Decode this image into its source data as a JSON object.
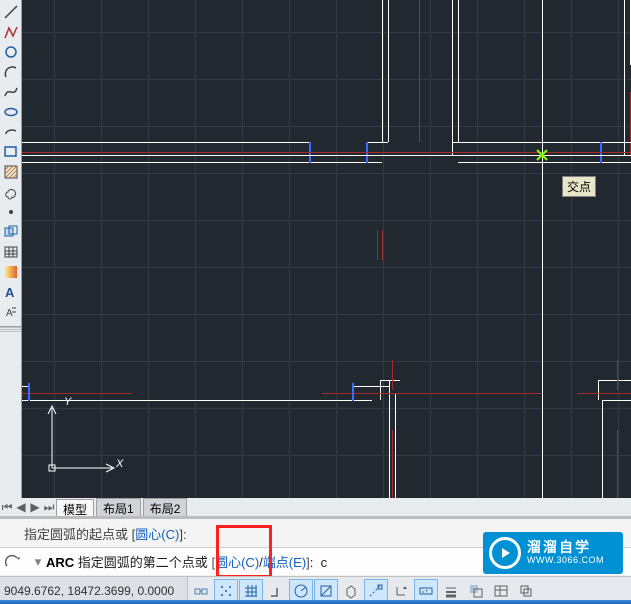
{
  "toolbar": {
    "icons": [
      "line-icon",
      "polyline-icon",
      "arc-icon",
      "spline-icon",
      "rectangle-icon",
      "revcloud-icon",
      "ellipse-icon",
      "hatch-icon",
      "point-icon",
      "region-icon",
      "table-icon",
      "text-icon",
      "mtext-icon",
      "gradient-icon"
    ]
  },
  "canvas": {
    "snap_label": "交点",
    "ucs_x": "X",
    "ucs_y": "Y"
  },
  "tabs": {
    "items": [
      "模型",
      "布局1",
      "布局2"
    ],
    "active_index": 0
  },
  "command": {
    "history_prefix": "指定圆弧的起点或",
    "history_opt_label": "圆心",
    "history_opt_key": "C",
    "prompt_cmd": "ARC",
    "prompt_text": "指定圆弧的第二个点或",
    "prompt_opts": [
      {
        "label": "圆心",
        "key": "C"
      },
      {
        "label": "端点",
        "key": "E"
      }
    ],
    "input_value": "c"
  },
  "status": {
    "coords": "9049.6762, 18472.3699, 0.0000",
    "buttons": [
      {
        "name": "infer-constraints",
        "active": false
      },
      {
        "name": "snap-mode",
        "active": true
      },
      {
        "name": "grid-display",
        "active": true
      },
      {
        "name": "ortho-mode",
        "active": false
      },
      {
        "name": "polar-tracking",
        "active": true
      },
      {
        "name": "object-snap",
        "active": true
      },
      {
        "name": "3d-osnap",
        "active": false
      },
      {
        "name": "otrack",
        "active": true
      },
      {
        "name": "ducs",
        "active": false
      },
      {
        "name": "dynamic-input",
        "active": true
      },
      {
        "name": "lineweight",
        "active": false
      },
      {
        "name": "transparency",
        "active": false
      },
      {
        "name": "quick-properties",
        "active": false
      },
      {
        "name": "selection-cycling",
        "active": false
      }
    ]
  },
  "watermark": {
    "title": "溜溜自学",
    "url": "WWW.3066.COM"
  }
}
